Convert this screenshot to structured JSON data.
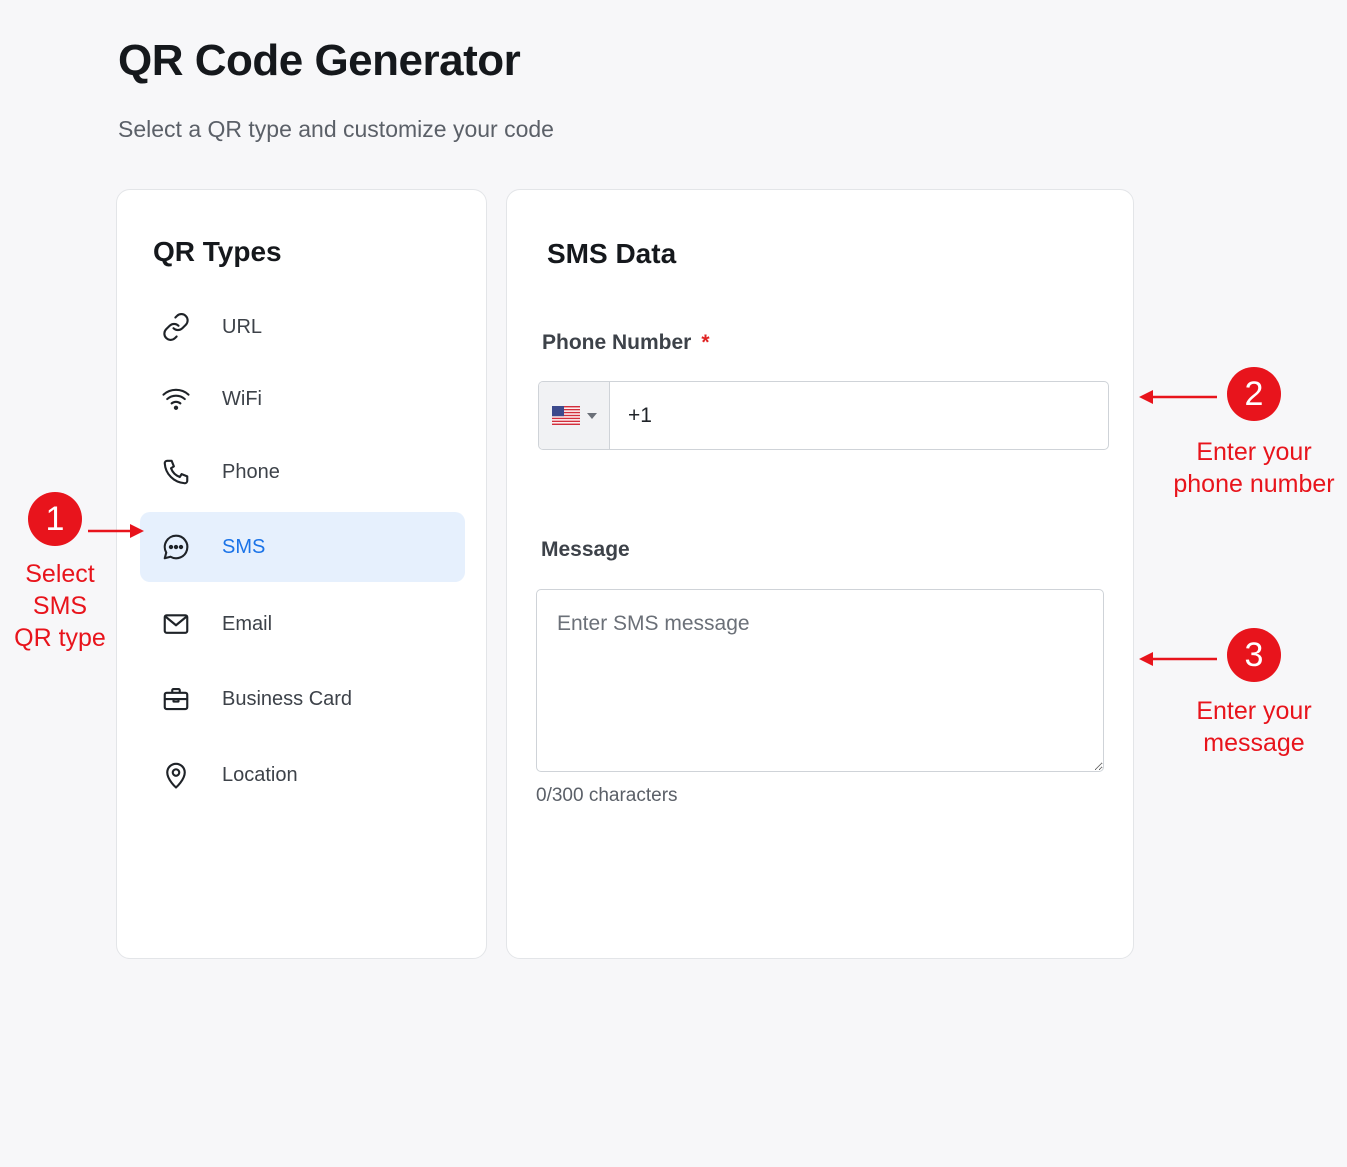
{
  "header": {
    "title": "QR Code Generator",
    "subtitle": "Select a QR type and customize your code"
  },
  "types_panel": {
    "title": "QR Types",
    "items": [
      {
        "label": "URL",
        "icon": "link-icon",
        "active": false
      },
      {
        "label": "WiFi",
        "icon": "wifi-icon",
        "active": false
      },
      {
        "label": "Phone",
        "icon": "phone-icon",
        "active": false
      },
      {
        "label": "SMS",
        "icon": "chat-bubble-icon",
        "active": true
      },
      {
        "label": "Email",
        "icon": "envelope-icon",
        "active": false
      },
      {
        "label": "Business Card",
        "icon": "briefcase-icon",
        "active": false
      },
      {
        "label": "Location",
        "icon": "map-pin-icon",
        "active": false
      }
    ]
  },
  "sms_form": {
    "title": "SMS Data",
    "phone": {
      "label": "Phone Number",
      "required_mark": "*",
      "country_flag": "us-flag-icon",
      "value": "+1"
    },
    "message": {
      "label": "Message",
      "placeholder": "Enter SMS message",
      "value": "",
      "char_count": "0/300 characters"
    }
  },
  "annotations": [
    {
      "number": "1",
      "text_line1": "Select SMS",
      "text_line2": "QR type"
    },
    {
      "number": "2",
      "text_line1": "Enter your",
      "text_line2": "phone number"
    },
    {
      "number": "3",
      "text_line1": "Enter your",
      "text_line2": "message"
    }
  ],
  "colors": {
    "accent": "#1a73e8",
    "active_bg": "#e6f0fd",
    "annotation_red": "#e8141c",
    "required_red": "#e02424"
  }
}
